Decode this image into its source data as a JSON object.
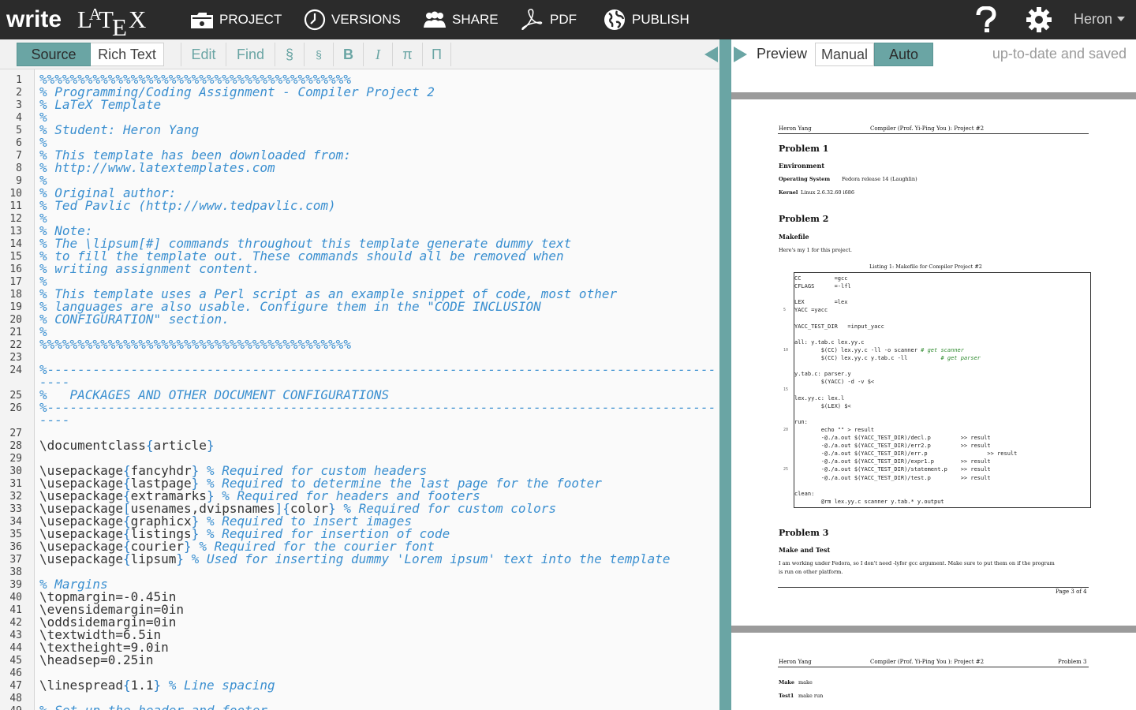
{
  "app": {
    "logo_write": "write",
    "logo_l": "L",
    "logo_a": "A",
    "logo_t": "T",
    "logo_e": "E",
    "logo_x": "X"
  },
  "nav": {
    "items": [
      {
        "label": "PROJECT"
      },
      {
        "label": "VERSIONS"
      },
      {
        "label": "SHARE"
      },
      {
        "label": "PDF"
      },
      {
        "label": "PUBLISH"
      }
    ],
    "user": "Heron"
  },
  "editor_toolbar": {
    "source": "Source",
    "rich": "Rich Text",
    "edit": "Edit",
    "find": "Find",
    "section": "§",
    "subsection": "§",
    "bold": "B",
    "italic": "I",
    "math_inline": "π",
    "math_display": "Π"
  },
  "code_lines": [
    {
      "n": "1",
      "segs": [
        [
          "c",
          "%%%%%%%%%%%%%%%%%%%%%%%%%%%%%%%%%%%%%%%%%"
        ]
      ]
    },
    {
      "n": "2",
      "segs": [
        [
          "c",
          "% Programming/Coding Assignment - Compiler Project 2"
        ]
      ]
    },
    {
      "n": "3",
      "segs": [
        [
          "c",
          "% LaTeX Template"
        ]
      ]
    },
    {
      "n": "4",
      "segs": [
        [
          "c",
          "%"
        ]
      ]
    },
    {
      "n": "5",
      "segs": [
        [
          "c",
          "% Student: Heron Yang"
        ]
      ]
    },
    {
      "n": "6",
      "segs": [
        [
          "c",
          "%"
        ]
      ]
    },
    {
      "n": "7",
      "segs": [
        [
          "c",
          "% This template has been downloaded from:"
        ]
      ]
    },
    {
      "n": "8",
      "segs": [
        [
          "c",
          "% http://www.latextemplates.com"
        ]
      ]
    },
    {
      "n": "9",
      "segs": [
        [
          "c",
          "%"
        ]
      ]
    },
    {
      "n": "10",
      "segs": [
        [
          "c",
          "% Original author:"
        ]
      ]
    },
    {
      "n": "11",
      "segs": [
        [
          "c",
          "% Ted Pavlic (http://www.tedpavlic.com)"
        ]
      ]
    },
    {
      "n": "12",
      "segs": [
        [
          "c",
          "%"
        ]
      ]
    },
    {
      "n": "13",
      "segs": [
        [
          "c",
          "% Note:"
        ]
      ]
    },
    {
      "n": "14",
      "segs": [
        [
          "c",
          "% The \\lipsum[#] commands throughout this template generate dummy text"
        ]
      ]
    },
    {
      "n": "15",
      "segs": [
        [
          "c",
          "% to fill the template out. These commands should all be removed when"
        ]
      ]
    },
    {
      "n": "16",
      "segs": [
        [
          "c",
          "% writing assignment content."
        ]
      ]
    },
    {
      "n": "17",
      "segs": [
        [
          "c",
          "%"
        ]
      ]
    },
    {
      "n": "18",
      "segs": [
        [
          "c",
          "% This template uses a Perl script as an example snippet of code, most other"
        ]
      ]
    },
    {
      "n": "19",
      "segs": [
        [
          "c",
          "% languages are also usable. Configure them in the \"CODE INCLUSION"
        ]
      ]
    },
    {
      "n": "20",
      "segs": [
        [
          "c",
          "% CONFIGURATION\" section."
        ]
      ]
    },
    {
      "n": "21",
      "segs": [
        [
          "c",
          "%"
        ]
      ]
    },
    {
      "n": "22",
      "segs": [
        [
          "c",
          "%%%%%%%%%%%%%%%%%%%%%%%%%%%%%%%%%%%%%%%%%"
        ]
      ]
    },
    {
      "n": "23",
      "segs": []
    },
    {
      "n": "24",
      "segs": [
        [
          "c",
          "%----------------------------------------------------------------------------------------"
        ]
      ],
      "wrap": "----"
    },
    {
      "n": "25",
      "segs": [
        [
          "c",
          "%   PACKAGES AND OTHER DOCUMENT CONFIGURATIONS"
        ]
      ]
    },
    {
      "n": "26",
      "segs": [
        [
          "c",
          "%----------------------------------------------------------------------------------------"
        ]
      ],
      "wrap": "----"
    },
    {
      "n": "27",
      "segs": []
    },
    {
      "n": "28",
      "segs": [
        [
          "t",
          "\\documentclass"
        ],
        [
          "b",
          "{"
        ],
        [
          "t",
          "article"
        ],
        [
          "b",
          "}"
        ]
      ]
    },
    {
      "n": "29",
      "segs": []
    },
    {
      "n": "30",
      "segs": [
        [
          "t",
          "\\usepackage"
        ],
        [
          "b",
          "{"
        ],
        [
          "t",
          "fancyhdr"
        ],
        [
          "b",
          "}"
        ],
        [
          "c",
          " % Required for custom headers"
        ]
      ]
    },
    {
      "n": "31",
      "segs": [
        [
          "t",
          "\\usepackage"
        ],
        [
          "b",
          "{"
        ],
        [
          "t",
          "lastpage"
        ],
        [
          "b",
          "}"
        ],
        [
          "c",
          " % Required to determine the last page for the footer"
        ]
      ]
    },
    {
      "n": "32",
      "segs": [
        [
          "t",
          "\\usepackage"
        ],
        [
          "b",
          "{"
        ],
        [
          "t",
          "extramarks"
        ],
        [
          "b",
          "}"
        ],
        [
          "c",
          " % Required for headers and footers"
        ]
      ]
    },
    {
      "n": "33",
      "segs": [
        [
          "t",
          "\\usepackage"
        ],
        [
          "b",
          "["
        ],
        [
          "t",
          "usenames,dvipsnames"
        ],
        [
          "b",
          "]{"
        ],
        [
          "t",
          "color"
        ],
        [
          "b",
          "}"
        ],
        [
          "c",
          " % Required for custom colors"
        ]
      ]
    },
    {
      "n": "34",
      "segs": [
        [
          "t",
          "\\usepackage"
        ],
        [
          "b",
          "{"
        ],
        [
          "t",
          "graphicx"
        ],
        [
          "b",
          "}"
        ],
        [
          "c",
          " % Required to insert images"
        ]
      ]
    },
    {
      "n": "35",
      "segs": [
        [
          "t",
          "\\usepackage"
        ],
        [
          "b",
          "{"
        ],
        [
          "t",
          "listings"
        ],
        [
          "b",
          "}"
        ],
        [
          "c",
          " % Required for insertion of code"
        ]
      ]
    },
    {
      "n": "36",
      "segs": [
        [
          "t",
          "\\usepackage"
        ],
        [
          "b",
          "{"
        ],
        [
          "t",
          "courier"
        ],
        [
          "b",
          "}"
        ],
        [
          "c",
          " % Required for the courier font"
        ]
      ]
    },
    {
      "n": "37",
      "segs": [
        [
          "t",
          "\\usepackage"
        ],
        [
          "b",
          "{"
        ],
        [
          "t",
          "lipsum"
        ],
        [
          "b",
          "}"
        ],
        [
          "c",
          " % Used for inserting dummy 'Lorem ipsum' text into the template"
        ]
      ]
    },
    {
      "n": "38",
      "segs": []
    },
    {
      "n": "39",
      "segs": [
        [
          "c",
          "% Margins"
        ]
      ]
    },
    {
      "n": "40",
      "segs": [
        [
          "t",
          "\\topmargin=-0.45in"
        ]
      ]
    },
    {
      "n": "41",
      "segs": [
        [
          "t",
          "\\evensidemargin=0in"
        ]
      ]
    },
    {
      "n": "42",
      "segs": [
        [
          "t",
          "\\oddsidemargin=0in"
        ]
      ]
    },
    {
      "n": "43",
      "segs": [
        [
          "t",
          "\\textwidth=6.5in"
        ]
      ]
    },
    {
      "n": "44",
      "segs": [
        [
          "t",
          "\\textheight=9.0in"
        ]
      ]
    },
    {
      "n": "45",
      "segs": [
        [
          "t",
          "\\headsep=0.25in"
        ]
      ]
    },
    {
      "n": "46",
      "segs": []
    },
    {
      "n": "47",
      "segs": [
        [
          "t",
          "\\linespread"
        ],
        [
          "b",
          "{"
        ],
        [
          "t",
          "1.1"
        ],
        [
          "b",
          "}"
        ],
        [
          "c",
          " % Line spacing"
        ]
      ]
    },
    {
      "n": "48",
      "segs": []
    },
    {
      "n": "49",
      "segs": [
        [
          "c",
          "% Set up the header and footer"
        ]
      ]
    }
  ],
  "preview_toolbar": {
    "label": "Preview",
    "manual": "Manual",
    "auto": "Auto",
    "status": "up-to-date and saved"
  },
  "pdf": {
    "header_left": "Heron Yang",
    "header_center": "Compiler (Prof. Yi-Ping You ): Project #2",
    "header_right_p4": "Problem 3",
    "p1_title": "Problem 1",
    "p1_sub": "Environment",
    "os_label": "Operating System",
    "os_value": "Fedora release 14 (Laughlin)",
    "kernel_label": "Kernel",
    "kernel_value": "Linux 2.6.32.60 i686",
    "p2_title": "Problem 2",
    "p2_sub": "Makefile",
    "p2_text": "Here's my 1 for this project.",
    "listing_caption": "Listing 1: Makefile for Compiler Project #2",
    "listing_lines": [
      "CC          =gcc",
      "CFLAGS      =-lfl",
      "",
      "LEX         =lex",
      "YACC =yacc",
      "",
      "YACC_TEST_DIR   =input_yacc",
      "",
      "all: y.tab.c lex.yy.c",
      "        $(CC) lex.yy.c -ll -o scanner # get scanner",
      "        $(CC) lex.yy.c y.tab.c -ll          # get parser",
      "",
      "y.tab.c: parser.y",
      "        $(YACC) -d -v $<",
      "",
      "lex.yy.c: lex.l",
      "        $(LEX) $<",
      "",
      "run:",
      "        echo \"\" > result",
      "        -@./a.out $(YACC_TEST_DIR)/decl.p         >> result",
      "        -@./a.out $(YACC_TEST_DIR)/err2.p         >> result",
      "        -@./a.out $(YACC_TEST_DIR)/err.p                  >> result",
      "        -@./a.out $(YACC_TEST_DIR)/expr1.p        >> result",
      "        -@./a.out $(YACC_TEST_DIR)/statement.p    >> result",
      "        -@./a.out $(YACC_TEST_DIR)/test.p         >> result",
      "",
      "clean:",
      "        @rm lex.yy.c scanner y.tab.* y.output"
    ],
    "listing_numbers": [
      "5",
      "10",
      "15",
      "20",
      "25"
    ],
    "p3_title": "Problem 3",
    "p3_sub": "Make and Test",
    "p3_text_1": "I am working under Fedora, so I don't need -lyfor gcc argument. Make sure to put them on if the program",
    "p3_text_2": "is run on other platform.",
    "footer": "Page 3 of 4",
    "p4_make_label": "Make",
    "p4_make_value": "make",
    "p4_test_label": "Test1",
    "p4_test_value": "make run"
  },
  "colors": {
    "accent": "#6aa5a4",
    "nav_bg": "#2b2b2b",
    "comment": "#3a8fd0"
  }
}
